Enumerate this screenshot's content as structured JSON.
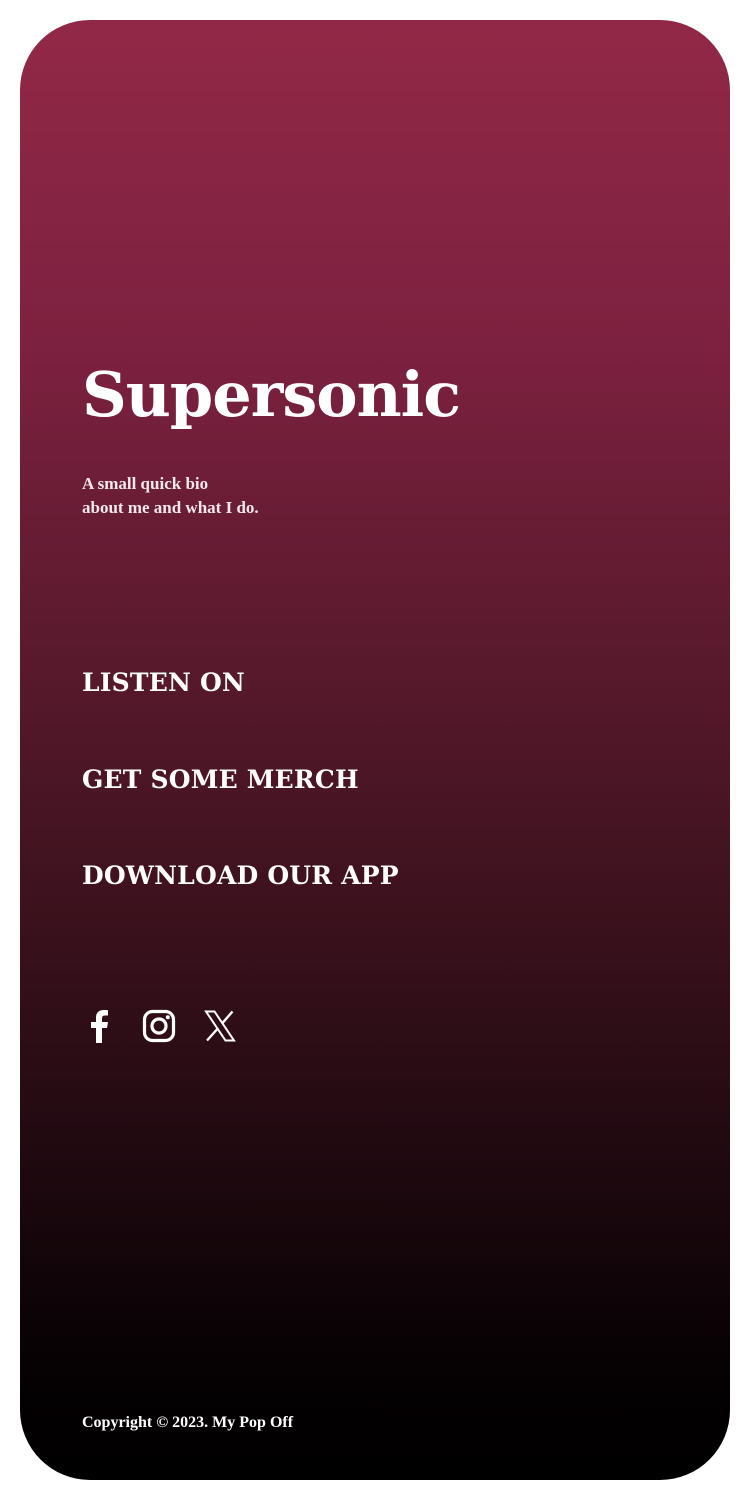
{
  "hero": {
    "title": "Supersonic",
    "bio_line1": "A small quick bio",
    "bio_line2": "about me and what I do."
  },
  "links": [
    {
      "label": "LISTEN ON"
    },
    {
      "label": "GET SOME MERCH"
    },
    {
      "label": "DOWNLOAD OUR APP"
    }
  ],
  "social": [
    {
      "icon": "facebook-icon"
    },
    {
      "icon": "instagram-icon"
    },
    {
      "icon": "x-icon"
    }
  ],
  "footer": {
    "copyright": "Copyright © 2023. My Pop Off"
  },
  "colors": {
    "gradient_top": "#922847",
    "gradient_bottom": "#000000",
    "text": "#ffffff"
  }
}
